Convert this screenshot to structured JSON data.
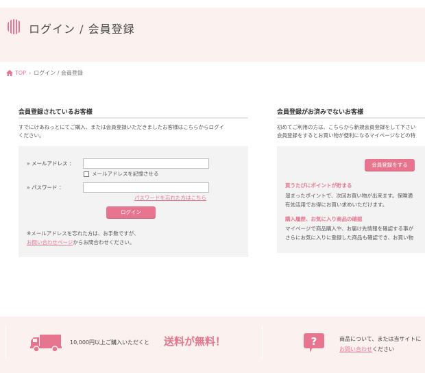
{
  "header": {
    "title": "ログイン / 会員登録"
  },
  "breadcrumb": {
    "items": [
      "TOP",
      "ログイン / 会員登録"
    ],
    "separator": "›"
  },
  "members": {
    "title": "会員登録されているお客様",
    "intro_line1": "すでにけあねっとにてご購入、または会員登録いただきましたお客様はこちらからログイ",
    "intro_line2": "ください。",
    "email_label": "» メールアドレス ：",
    "email_value": "",
    "remember_label": "メールアドレスを記憶させる",
    "password_label": "» パスワード ：",
    "password_value": "",
    "forgot_link": "パスワードを忘れた方はこちら",
    "login_button": "ログイン",
    "note_line1": "※メールアドレスを忘れた方は、お手数ですが、",
    "note_link": "お問い合わせページ",
    "note_line2_rest": "からお問合わせください。"
  },
  "new_customers": {
    "title": "会員登録がお済みでないお客様",
    "intro_line1": "初めてご利用の方は、こちらから新規会員登録をして下さい",
    "intro_line2": "会員登録をするとお買い物が便利になるマイページなどの特",
    "register_button": "会員登録をする",
    "feature1_title": "買うたびにポイントが貯まる",
    "feature1_line1": "溜まったポイントで、次回お買い物が出来ます。保険適",
    "feature1_line2": "有効活用でお得にお買い求めいただけます。",
    "feature2_title": "購入履歴、お気に入り商品の確認",
    "feature2_line1": "マイページで商品購入や、お届け先情報を確認する事が",
    "feature2_line2": "さらにお気に入りに登録した商品も確認でき、お買い物"
  },
  "footer": {
    "shipping_text": "10,000円以上ご購入いただくと",
    "shipping_highlight": "送料が無料！",
    "contact_line1": "商品について、または当サイトに",
    "contact_link": "お問い合わせ",
    "contact_rest": "ください"
  },
  "colors": {
    "accent": "#e8758f",
    "band": "#fbf1ee",
    "panel": "#f3f3f3"
  },
  "icons": {
    "header": "stripes-icon",
    "breadcrumb": "home-icon",
    "shipping": "truck-icon",
    "contact": "question-icon"
  }
}
